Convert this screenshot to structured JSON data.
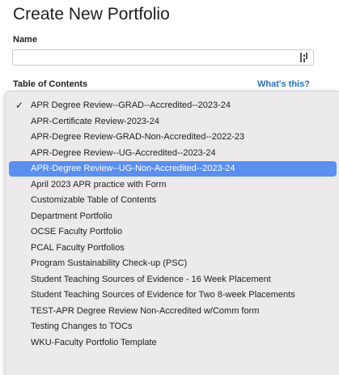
{
  "page": {
    "title": "Create New Portfolio",
    "name_label": "Name",
    "name_value": "",
    "toc_label": "Table of Contents",
    "whats_this": "What's this?"
  },
  "toc_options": [
    {
      "label": "APR Degree Review--GRAD--Accredited--2023-24",
      "checked": true,
      "highlighted": false
    },
    {
      "label": "APR-Certificate Review-2023-24",
      "checked": false,
      "highlighted": false
    },
    {
      "label": "APR-Degree Review-GRAD-Non-Accredited--2022-23",
      "checked": false,
      "highlighted": false
    },
    {
      "label": "APR-Degree Review--UG-Accredited--2023-24",
      "checked": false,
      "highlighted": false
    },
    {
      "label": "APR-Degree Review--UG-Non-Accredited--2023-24",
      "checked": false,
      "highlighted": true
    },
    {
      "label": "April 2023 APR practice with Form",
      "checked": false,
      "highlighted": false
    },
    {
      "label": "Customizable Table of Contents",
      "checked": false,
      "highlighted": false
    },
    {
      "label": "Department Portfolio",
      "checked": false,
      "highlighted": false
    },
    {
      "label": "OCSE Faculty Portfolio",
      "checked": false,
      "highlighted": false
    },
    {
      "label": "PCAL Faculty Portfolios",
      "checked": false,
      "highlighted": false
    },
    {
      "label": "Program Sustainability Check-up (PSC)",
      "checked": false,
      "highlighted": false
    },
    {
      "label": "Student Teaching Sources of Evidence - 16 Week Placement",
      "checked": false,
      "highlighted": false
    },
    {
      "label": "Student Teaching Sources of Evidence for Two 8-week Placements",
      "checked": false,
      "highlighted": false
    },
    {
      "label": "TEST-APR Degree Review Non-Accredited w/Comm form",
      "checked": false,
      "highlighted": false
    },
    {
      "label": "Testing Changes to TOCs",
      "checked": false,
      "highlighted": false
    },
    {
      "label": "WKU-Faculty Portfolio Template",
      "checked": false,
      "highlighted": false
    }
  ],
  "check_glyph": "✓",
  "icons": {
    "password_manager": "password-manager-icon"
  },
  "colors": {
    "highlight": "#5a8ff0",
    "link": "#2a6ebb",
    "menu_bg": "#eceaea"
  }
}
